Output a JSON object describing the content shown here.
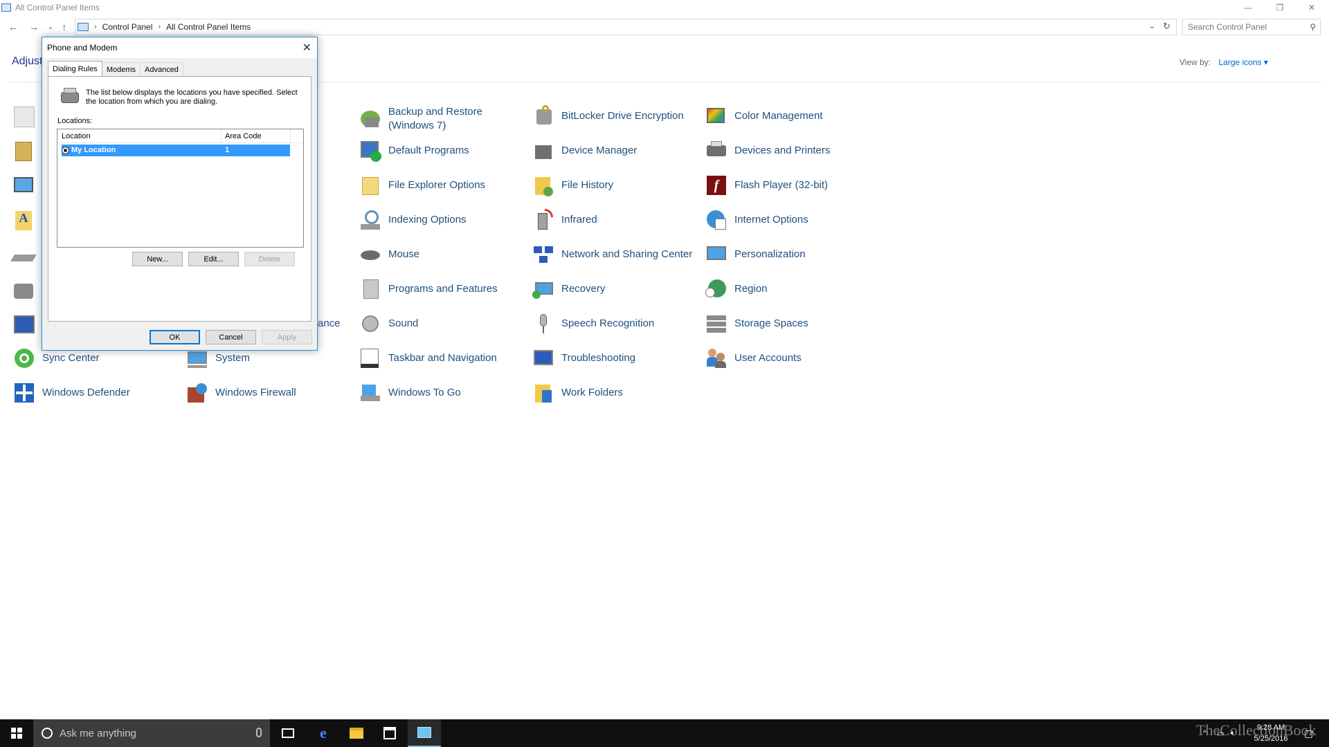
{
  "window": {
    "title": "All Control Panel Items"
  },
  "address": {
    "breadcrumbs": [
      "Control Panel",
      "All Control Panel Items"
    ],
    "search_placeholder": "Search Control Panel"
  },
  "header": {
    "heading": "Adjust",
    "view_by_label": "View by:",
    "view_by_value": "Large icons"
  },
  "items": [
    {
      "label": "Backup and Restore (Windows 7)",
      "icon": "backup-restore-icon"
    },
    {
      "label": "BitLocker Drive Encryption",
      "icon": "bitlocker-icon"
    },
    {
      "label": "Color Management",
      "icon": "color-management-icon"
    },
    {
      "label": "Default Programs",
      "icon": "default-programs-icon"
    },
    {
      "label": "Device Manager",
      "icon": "device-manager-icon"
    },
    {
      "label": "Devices and Printers",
      "icon": "devices-printers-icon"
    },
    {
      "label": "File Explorer Options",
      "icon": "file-explorer-options-icon"
    },
    {
      "label": "File History",
      "icon": "file-history-icon"
    },
    {
      "label": "Flash Player (32-bit)",
      "icon": "flash-player-icon"
    },
    {
      "label": "Indexing Options",
      "icon": "indexing-options-icon"
    },
    {
      "label": "Infrared",
      "icon": "infrared-icon"
    },
    {
      "label": "Internet Options",
      "icon": "internet-options-icon"
    },
    {
      "label": "Mouse",
      "icon": "mouse-icon"
    },
    {
      "label": "Network and Sharing Center",
      "icon": "network-sharing-icon"
    },
    {
      "label": "Personalization",
      "icon": "personalization-icon"
    },
    {
      "label": "Programs and Features",
      "icon": "programs-features-icon"
    },
    {
      "label": "Recovery",
      "icon": "recovery-icon"
    },
    {
      "label": "Region",
      "icon": "region-icon"
    },
    {
      "label": "Sound",
      "icon": "sound-icon"
    },
    {
      "label": "Speech Recognition",
      "icon": "speech-recognition-icon"
    },
    {
      "label": "Storage Spaces",
      "icon": "storage-spaces-icon"
    },
    {
      "label": "Taskbar and Navigation",
      "icon": "taskbar-navigation-icon"
    },
    {
      "label": "Troubleshooting",
      "icon": "troubleshooting-icon"
    },
    {
      "label": "User Accounts",
      "icon": "user-accounts-icon"
    },
    {
      "label": "Sync Center",
      "icon": "sync-center-icon"
    },
    {
      "label": "System",
      "icon": "system-icon"
    },
    {
      "label": "Windows Defender",
      "icon": "windows-defender-icon"
    },
    {
      "label": "Windows Firewall",
      "icon": "windows-firewall-icon"
    },
    {
      "label": "Windows To Go",
      "icon": "windows-to-go-icon"
    },
    {
      "label": "Work Folders",
      "icon": "work-folders-icon"
    },
    {
      "label": "ance",
      "icon": ""
    }
  ],
  "dialog": {
    "title": "Phone and Modem",
    "tabs": [
      "Dialing Rules",
      "Modems",
      "Advanced"
    ],
    "description": "The list below displays the locations you have specified. Select the location from which you are dialing.",
    "locations_label": "Locations:",
    "columns": [
      "Location",
      "Area Code"
    ],
    "rows": [
      {
        "location": "My Location",
        "area_code": "1"
      }
    ],
    "buttons": {
      "new": "New...",
      "edit": "Edit...",
      "delete": "Delete",
      "ok": "OK",
      "cancel": "Cancel",
      "apply": "Apply"
    }
  },
  "taskbar": {
    "search_placeholder": "Ask me anything",
    "time": "9:28 AM",
    "date": "5/25/2016",
    "watermark": "TheCollectionBook"
  },
  "colors": {
    "link": "#1e4f7e",
    "accent": "#0078d7",
    "selection": "#3399ff",
    "taskbar": "#101010"
  }
}
